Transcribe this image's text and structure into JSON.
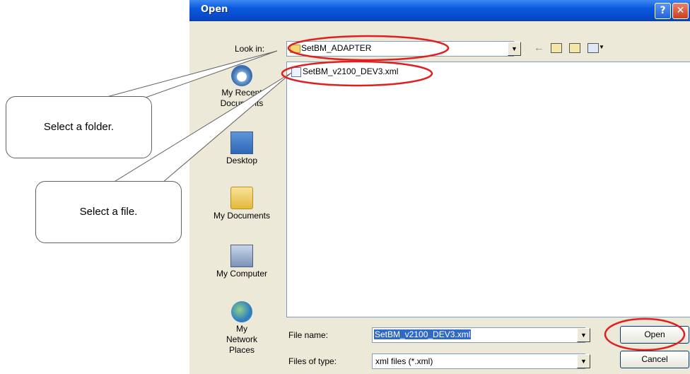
{
  "dialog": {
    "title": "Open",
    "help_button": "?",
    "close_button": "✕",
    "look_in_label": "Look in:",
    "look_in_value": "SetBM_ADAPTER",
    "places": [
      {
        "label": "My Recent Documents",
        "icon": "recent-documents-icon"
      },
      {
        "label": "Desktop",
        "icon": "desktop-icon"
      },
      {
        "label": "My Documents",
        "icon": "my-documents-icon"
      },
      {
        "label": "My Computer",
        "icon": "my-computer-icon"
      },
      {
        "label": "My Network Places",
        "icon": "network-places-icon"
      }
    ],
    "files": [
      {
        "name": "SetBM_v2100_DEV3.xml",
        "icon": "xml-file-icon"
      }
    ],
    "file_name_label": "File name:",
    "file_name_value": "SetBM_v2100_DEV3.xml",
    "files_of_type_label": "Files of type:",
    "files_of_type_value": "xml files (*.xml)",
    "open_button": "Open",
    "cancel_button": "Cancel"
  },
  "callouts": {
    "folder": "Select a folder.",
    "file": "Select a file."
  },
  "colors": {
    "titlebar": "#0a58de",
    "dialog_bg": "#ece9d8",
    "highlight_ellipse": "#e02020",
    "selection": "#316ac5"
  }
}
